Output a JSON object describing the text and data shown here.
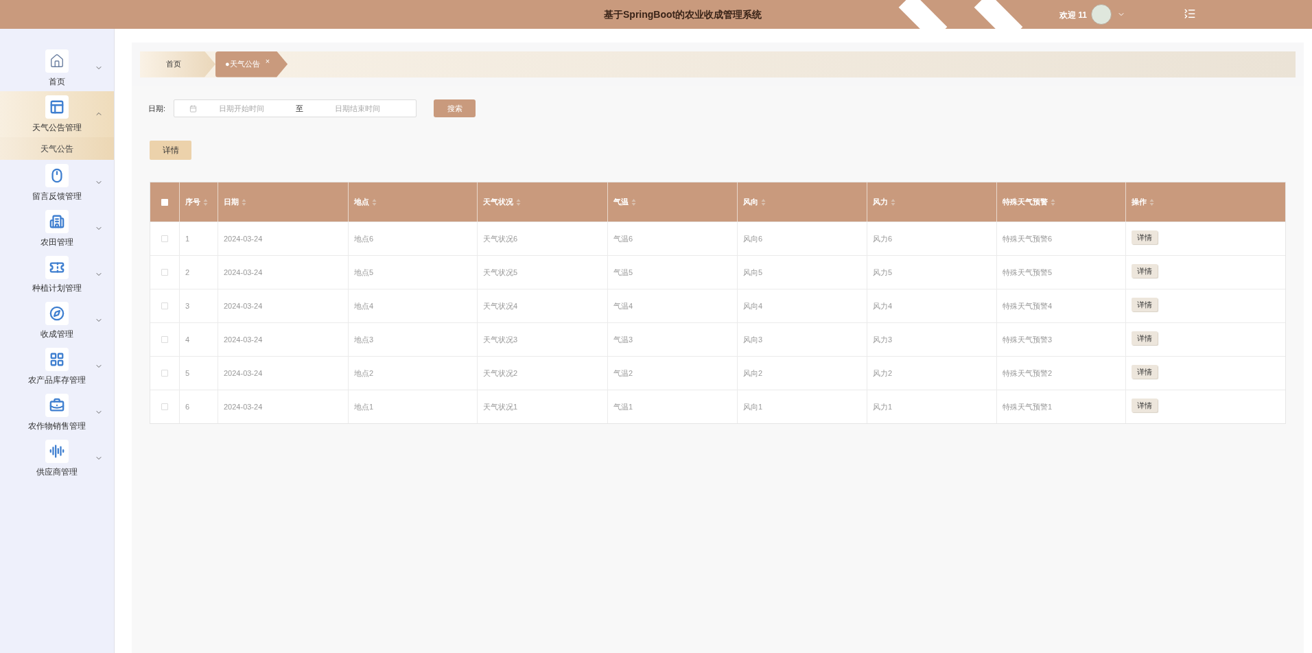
{
  "header": {
    "title": "基于SpringBoot的农业收成管理系统",
    "welcome": "欢迎 11"
  },
  "sidebar": {
    "items": [
      {
        "label": "首页",
        "expanded": false
      },
      {
        "label": "天气公告管理",
        "expanded": true,
        "children": [
          {
            "label": "天气公告",
            "selected": true
          }
        ]
      },
      {
        "label": "留言反馈管理",
        "expanded": false
      },
      {
        "label": "农田管理",
        "expanded": false
      },
      {
        "label": "种植计划管理",
        "expanded": false
      },
      {
        "label": "收成管理",
        "expanded": false
      },
      {
        "label": "农产品库存管理",
        "expanded": false
      },
      {
        "label": "农作物销售管理",
        "expanded": false
      },
      {
        "label": "供应商管理",
        "expanded": false
      }
    ]
  },
  "breadcrumb": {
    "tabs": [
      {
        "label": "首页",
        "selected": false
      },
      {
        "label": "●天气公告",
        "selected": true,
        "close": "×"
      }
    ]
  },
  "search": {
    "label": "日期:",
    "start_placeholder": "日期开始时间",
    "separator": "至",
    "end_placeholder": "日期结束时间",
    "button": "搜索"
  },
  "detail_button": "详情",
  "table": {
    "all_checked": false,
    "columns": [
      "序号",
      "日期",
      "地点",
      "天气状况",
      "气温",
      "风向",
      "风力",
      "特殊天气预警",
      "操作"
    ],
    "rows": [
      {
        "checked": false,
        "cells": [
          "1",
          "2024-03-24",
          "地点6",
          "天气状况6",
          "气温6",
          "风向6",
          "风力6",
          "特殊天气预警6"
        ],
        "action": "详情"
      },
      {
        "checked": false,
        "cells": [
          "2",
          "2024-03-24",
          "地点5",
          "天气状况5",
          "气温5",
          "风向5",
          "风力5",
          "特殊天气预警5"
        ],
        "action": "详情"
      },
      {
        "checked": false,
        "cells": [
          "3",
          "2024-03-24",
          "地点4",
          "天气状况4",
          "气温4",
          "风向4",
          "风力4",
          "特殊天气预警4"
        ],
        "action": "详情"
      },
      {
        "checked": false,
        "cells": [
          "4",
          "2024-03-24",
          "地点3",
          "天气状况3",
          "气温3",
          "风向3",
          "风力3",
          "特殊天气预警3"
        ],
        "action": "详情"
      },
      {
        "checked": false,
        "cells": [
          "5",
          "2024-03-24",
          "地点2",
          "天气状况2",
          "气温2",
          "风向2",
          "风力2",
          "特殊天气预警2"
        ],
        "action": "详情"
      },
      {
        "checked": false,
        "cells": [
          "6",
          "2024-03-24",
          "地点1",
          "天气状况1",
          "气温1",
          "风向1",
          "风力1",
          "特殊天气预警1"
        ],
        "action": "详情"
      }
    ]
  }
}
